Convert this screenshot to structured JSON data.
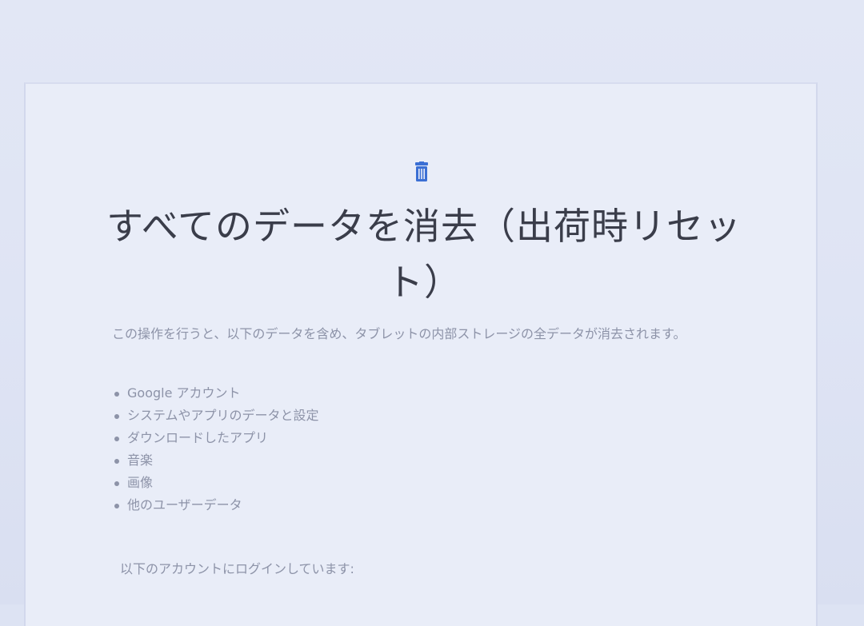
{
  "screen": {
    "title": "すべてのデータを消去（出荷時リセット）",
    "intro": "この操作を行うと、以下のデータを含め、タブレットの内部ストレージの全データが消去されます。",
    "items": [
      "Google アカウント",
      "システムやアプリのデータと設定",
      "ダウンロードしたアプリ",
      "音楽",
      "画像",
      "他のユーザーデータ"
    ],
    "accounts_heading": "以下のアカウントにログインしています:"
  },
  "colors": {
    "accent": "#3b6fd4",
    "title_text": "#3a3d4a",
    "body_text": "#8d93a8",
    "background": "#e9edf8"
  },
  "icons": {
    "header_icon": "trash-icon"
  }
}
